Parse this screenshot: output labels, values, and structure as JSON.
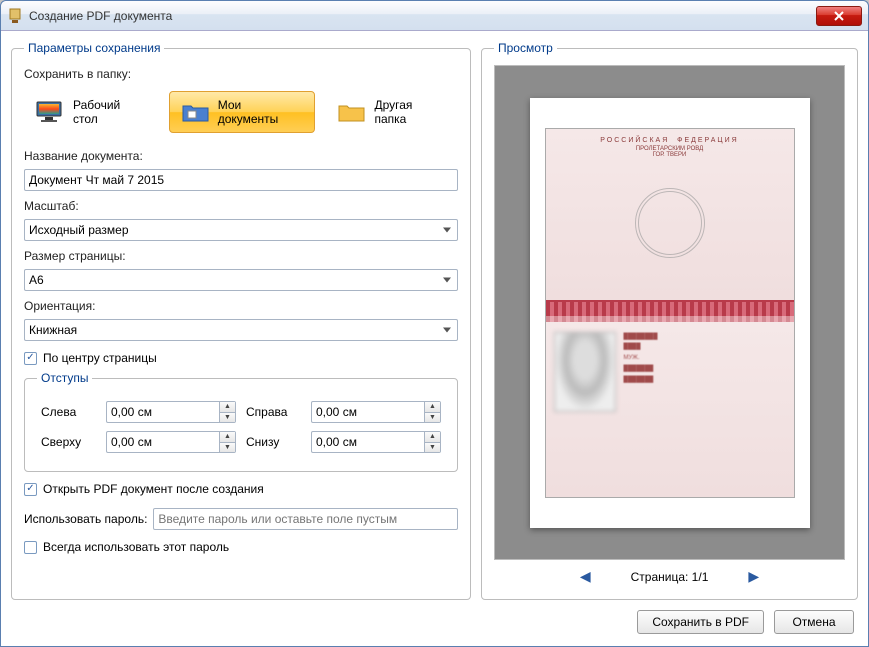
{
  "window": {
    "title": "Создание PDF документа"
  },
  "left": {
    "legend": "Параметры сохранения",
    "save_to": "Сохранить в папку:",
    "folders": {
      "desktop": "Рабочий стол",
      "documents": "Мои документы",
      "other": "Другая папка"
    },
    "doc_name_label": "Название документа:",
    "doc_name_value": "Документ Чт май 7 2015",
    "scale_label": "Масштаб:",
    "scale_value": "Исходный размер",
    "page_size_label": "Размер страницы:",
    "page_size_value": "A6",
    "orientation_label": "Ориентация:",
    "orientation_value": "Книжная",
    "center_label": "По центру страницы",
    "margins_legend": "Отступы",
    "margins": {
      "left_label": "Слева",
      "left_value": "0,00 см",
      "right_label": "Справа",
      "right_value": "0,00 см",
      "top_label": "Сверху",
      "top_value": "0,00 см",
      "bottom_label": "Снизу",
      "bottom_value": "0,00 см"
    },
    "open_after_label": "Открыть PDF документ после создания",
    "password_label": "Использовать пароль:",
    "password_placeholder": "Введите пароль или оставьте поле пустым",
    "always_password_label": "Всегда использовать этот пароль"
  },
  "right": {
    "legend": "Просмотр",
    "page_indicator": "Страница: 1/1"
  },
  "buttons": {
    "save": "Сохранить в PDF",
    "cancel": "Отмена"
  }
}
